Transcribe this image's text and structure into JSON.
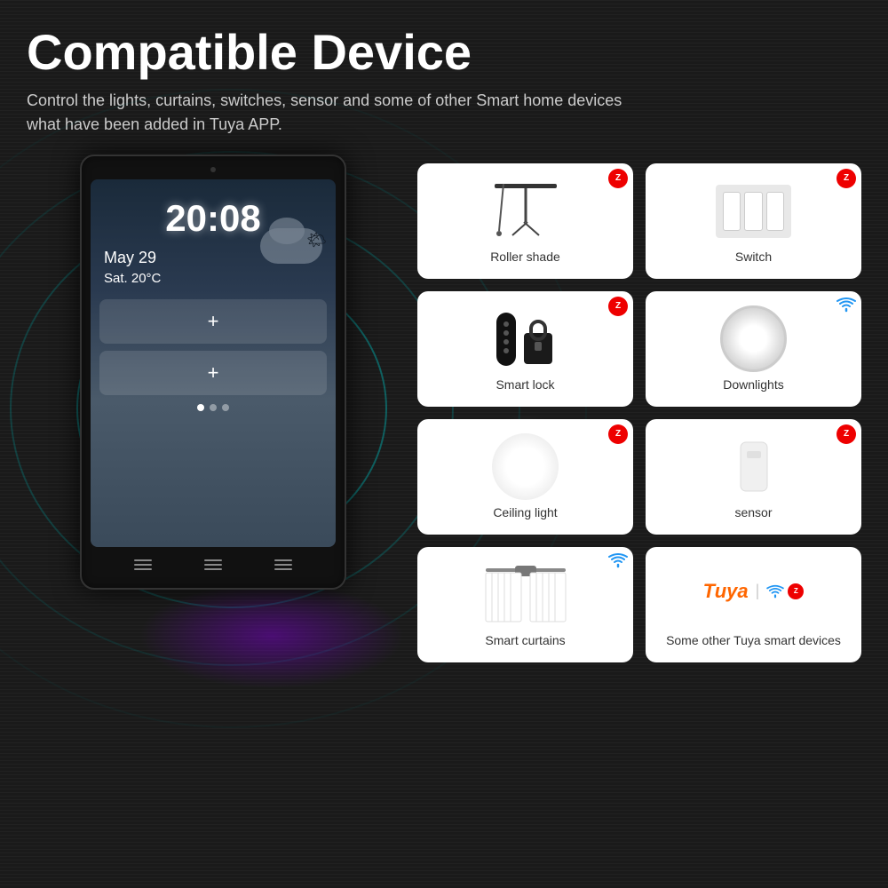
{
  "header": {
    "title": "Compatible Device",
    "subtitle": "Control the lights, curtains, switches, sensor and some of other Smart home devices what have been added in Tuya APP."
  },
  "screen": {
    "time": "20:08",
    "date": "May 29",
    "day_temp": "Sat.       20°C",
    "dots": [
      true,
      false,
      false
    ]
  },
  "devices": [
    {
      "id": "roller-shade",
      "label": "Roller shade",
      "badge": "zigbee",
      "badge_text": "Z"
    },
    {
      "id": "switch",
      "label": "Switch",
      "badge": "zigbee",
      "badge_text": "Z"
    },
    {
      "id": "smart-lock",
      "label": "Smart lock",
      "badge": "zigbee",
      "badge_text": "Z"
    },
    {
      "id": "downlights",
      "label": "Downlights",
      "badge": "wifi",
      "badge_text": "wifi"
    },
    {
      "id": "ceiling-light",
      "label": "Ceiling light",
      "badge": "zigbee",
      "badge_text": "Z"
    },
    {
      "id": "sensor",
      "label": "sensor",
      "badge": "zigbee",
      "badge_text": "Z"
    },
    {
      "id": "smart-curtains",
      "label": "Smart curtains",
      "badge": "wifi",
      "badge_text": "wifi"
    },
    {
      "id": "tuya-devices",
      "label": "Some other Tuya smart devices",
      "badge": "both",
      "tuya_logo": "Tuya",
      "divider": "|"
    }
  ],
  "buttons": [
    {
      "label": "≡"
    },
    {
      "label": "≡"
    },
    {
      "label": "≡"
    }
  ]
}
